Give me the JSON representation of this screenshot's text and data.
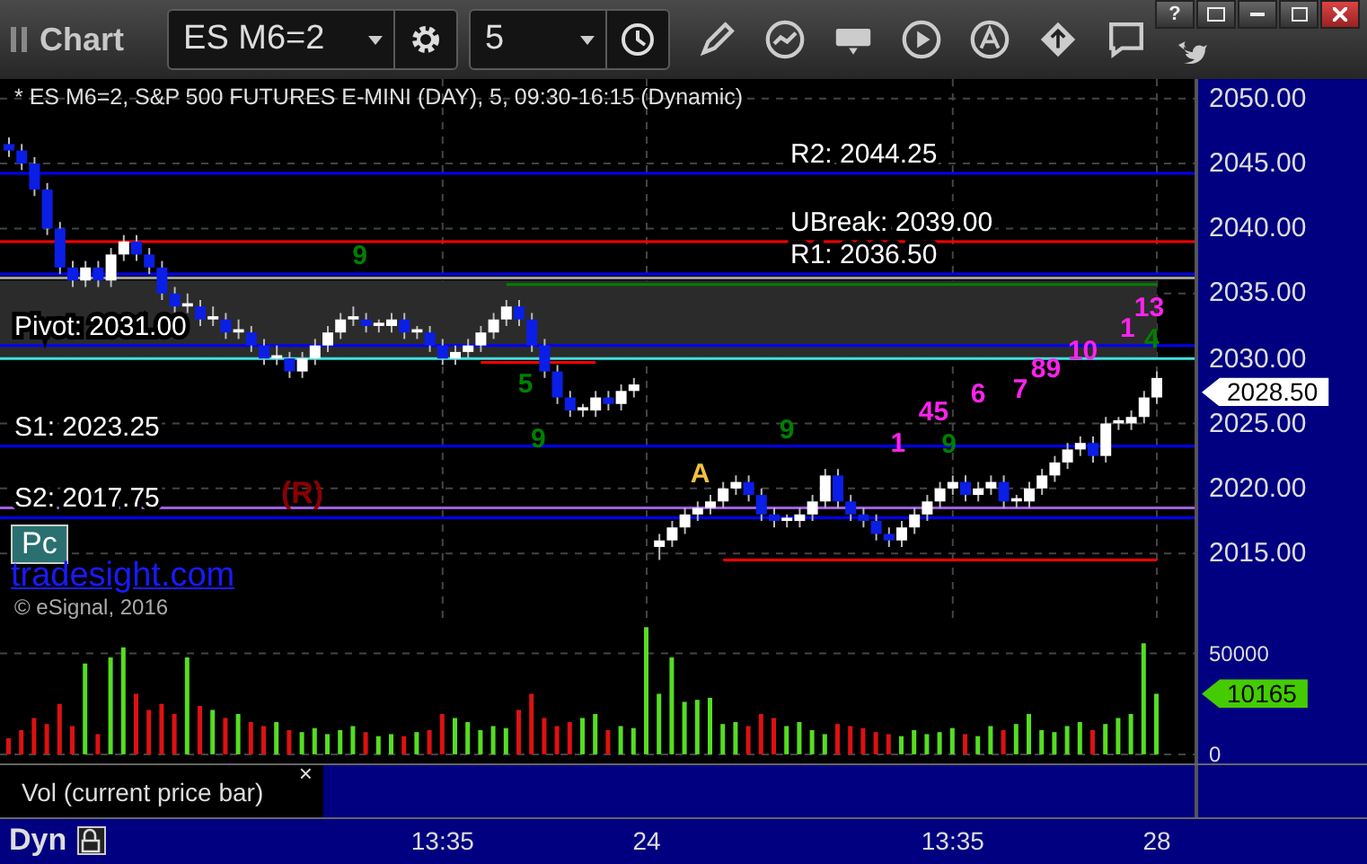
{
  "toolbar": {
    "title": "Chart",
    "symbol": "ES M6=2",
    "interval": "5",
    "help": "?"
  },
  "price_chart": {
    "title": "* ES M6=2, S&P 500 FUTURES E-MINI (DAY), 5, 09:30-16:15 (Dynamic)",
    "last_price": "2028.50",
    "badge": "Pc",
    "link": "tradesight.com",
    "copyright": "© eSignal, 2016",
    "markers": [
      {
        "text": "(R)",
        "color": "#8b0000"
      },
      {
        "text": "9",
        "color": "#008000"
      },
      {
        "text": "5",
        "color": "#008000"
      },
      {
        "text": "9",
        "color": "#008000"
      },
      {
        "text": "A",
        "color": "#f0c040"
      },
      {
        "text": "9",
        "color": "#008000"
      },
      {
        "text": "1",
        "color": "#ff22ee"
      },
      {
        "text": "45",
        "color": "#ff22ee"
      },
      {
        "text": "9",
        "color": "#008000"
      },
      {
        "text": "6",
        "color": "#ff22ee"
      },
      {
        "text": "7",
        "color": "#ff22ee"
      },
      {
        "text": "89",
        "color": "#ff22ee"
      },
      {
        "text": "10",
        "color": "#ff22ee"
      },
      {
        "text": "1",
        "color": "#ff22ee"
      },
      {
        "text": "13",
        "color": "#ff22ee"
      },
      {
        "text": "4",
        "color": "#008000"
      }
    ],
    "chart_data": {
      "type": "candlestick",
      "ohlc": [
        [
          2046.5,
          2047,
          2045.5,
          2046
        ],
        [
          2046,
          2046.5,
          2044.5,
          2045
        ],
        [
          2045,
          2045.5,
          2042.5,
          2043
        ],
        [
          2043,
          2043.5,
          2039.5,
          2040
        ],
        [
          2040,
          2040.5,
          2036.5,
          2037
        ],
        [
          2037,
          2037.5,
          2035.5,
          2036
        ],
        [
          2036,
          2037.5,
          2035.5,
          2037
        ],
        [
          2037,
          2037.5,
          2035.5,
          2036
        ],
        [
          2036,
          2038.5,
          2035.5,
          2038
        ],
        [
          2038,
          2039.5,
          2037.5,
          2039
        ],
        [
          2039,
          2039.5,
          2037.5,
          2038
        ],
        [
          2038,
          2038.5,
          2036.5,
          2037
        ],
        [
          2037,
          2037.5,
          2034.5,
          2035
        ],
        [
          2035,
          2035.5,
          2033.5,
          2034
        ],
        [
          2034,
          2035,
          2033.5,
          2034.25
        ],
        [
          2034,
          2034.5,
          2032.5,
          2033
        ],
        [
          2033,
          2034,
          2032.5,
          2033.25
        ],
        [
          2033,
          2033.5,
          2031.5,
          2032
        ],
        [
          2032,
          2033,
          2031.5,
          2032.25
        ],
        [
          2032,
          2032.5,
          2030.5,
          2031
        ],
        [
          2031,
          2031.5,
          2029.5,
          2030
        ],
        [
          2030,
          2031,
          2029.5,
          2030.25
        ],
        [
          2030,
          2030.5,
          2028.5,
          2029
        ],
        [
          2029,
          2030.5,
          2028.5,
          2030
        ],
        [
          2030,
          2031.5,
          2029.5,
          2031
        ],
        [
          2031,
          2032.5,
          2030.5,
          2032
        ],
        [
          2032,
          2033.5,
          2031.5,
          2033
        ],
        [
          2033,
          2034,
          2032.5,
          2033.25
        ],
        [
          2033,
          2033.5,
          2032,
          2032.5
        ],
        [
          2032.5,
          2033,
          2032,
          2032.75
        ],
        [
          2032.5,
          2033.5,
          2032,
          2033
        ],
        [
          2033,
          2033.5,
          2031.5,
          2032
        ],
        [
          2032,
          2032.5,
          2031.5,
          2032.25
        ],
        [
          2032,
          2032.5,
          2030.5,
          2031
        ],
        [
          2031,
          2031.5,
          2029.5,
          2030
        ],
        [
          2030,
          2031,
          2029.5,
          2030.5
        ],
        [
          2030.5,
          2031.5,
          2030,
          2031
        ],
        [
          2031,
          2032.5,
          2030.5,
          2032
        ],
        [
          2032,
          2033.5,
          2031.5,
          2033
        ],
        [
          2033,
          2034.5,
          2032.5,
          2034
        ],
        [
          2034,
          2034.5,
          2032.5,
          2033
        ],
        [
          2033,
          2033.5,
          2030.5,
          2031
        ],
        [
          2031,
          2031.5,
          2028.5,
          2029
        ],
        [
          2029,
          2029.5,
          2026.5,
          2027
        ],
        [
          2027,
          2027.5,
          2025.5,
          2026
        ],
        [
          2026,
          2026.5,
          2025.5,
          2026.25
        ],
        [
          2026,
          2027.5,
          2025.5,
          2027
        ],
        [
          2027,
          2027.5,
          2026,
          2026.5
        ],
        [
          2026.5,
          2028,
          2026,
          2027.5
        ],
        [
          2027.5,
          2028.5,
          2027,
          2028
        ],
        null,
        [
          2015.5,
          2016.5,
          2014.5,
          2016
        ],
        [
          2016,
          2017.5,
          2015.5,
          2017
        ],
        [
          2017,
          2018.5,
          2016.5,
          2018
        ],
        [
          2018,
          2019,
          2017.5,
          2018.5
        ],
        [
          2018.5,
          2019.5,
          2018,
          2019
        ],
        [
          2019,
          2020.5,
          2018.5,
          2020
        ],
        [
          2020,
          2021,
          2019.5,
          2020.5
        ],
        [
          2020.5,
          2021,
          2019,
          2019.5
        ],
        [
          2019.5,
          2020,
          2017.5,
          2018
        ],
        [
          2018,
          2018.5,
          2017,
          2017.5
        ],
        [
          2017.5,
          2018,
          2017,
          2017.75
        ],
        [
          2017.5,
          2018.5,
          2017,
          2018
        ],
        [
          2018,
          2019.5,
          2017.5,
          2019
        ],
        [
          2019,
          2021.5,
          2018.5,
          2021
        ],
        [
          2021,
          2021.5,
          2018.5,
          2019
        ],
        [
          2019,
          2019.5,
          2017.5,
          2018
        ],
        [
          2018,
          2018.5,
          2017,
          2017.5
        ],
        [
          2017.5,
          2018,
          2016,
          2016.5
        ],
        [
          2016.5,
          2017,
          2015.5,
          2016
        ],
        [
          2016,
          2017.5,
          2015.5,
          2017
        ],
        [
          2017,
          2018.5,
          2016.5,
          2018
        ],
        [
          2018,
          2019.5,
          2017.5,
          2019
        ],
        [
          2019,
          2020.5,
          2018.5,
          2020
        ],
        [
          2020,
          2021,
          2019.5,
          2020.5
        ],
        [
          2020.5,
          2021,
          2019,
          2019.5
        ],
        [
          2019.5,
          2020.5,
          2019,
          2020
        ],
        [
          2020,
          2021,
          2019.5,
          2020.5
        ],
        [
          2020.5,
          2021,
          2018.5,
          2019
        ],
        [
          2019,
          2019.5,
          2018.5,
          2019.25
        ],
        [
          2019,
          2020.5,
          2018.5,
          2020
        ],
        [
          2020,
          2021.5,
          2019.5,
          2021
        ],
        [
          2021,
          2022.5,
          2020.5,
          2022
        ],
        [
          2022,
          2023.5,
          2021.5,
          2023
        ],
        [
          2023,
          2024,
          2022.5,
          2023.5
        ],
        [
          2023.5,
          2024,
          2022,
          2022.5
        ],
        [
          2022.5,
          2025.5,
          2022,
          2025
        ],
        [
          2025,
          2025.5,
          2024.5,
          2025.25
        ],
        [
          2025,
          2026,
          2024.5,
          2025.5
        ],
        [
          2025.5,
          2027.5,
          2025,
          2027
        ],
        [
          2027,
          2029,
          2026.5,
          2028.5
        ]
      ],
      "ylim": [
        2009.9,
        2051.5
      ],
      "yticks": [
        {
          "value": 2015,
          "label": "2015.00"
        },
        {
          "value": 2020,
          "label": "2020.00"
        },
        {
          "value": 2025,
          "label": "2025.00"
        },
        {
          "value": 2030,
          "label": "2030.00"
        },
        {
          "value": 2035,
          "label": "2035.00"
        },
        {
          "value": 2040,
          "label": "2040.00"
        },
        {
          "value": 2045,
          "label": "2045.00"
        },
        {
          "value": 2050,
          "label": "2050.00"
        }
      ],
      "grid": true,
      "bands": [
        {
          "axis": "y",
          "from": 2030,
          "to": 2036,
          "color": "#2b2b2b"
        }
      ],
      "ref_lines": [
        {
          "axis": "y",
          "value": 2044.25,
          "color": "#0000ff",
          "label": "R2: 2044.25"
        },
        {
          "axis": "y",
          "value": 2039,
          "color": "#ff0000",
          "label": "UBreak: 2039.00"
        },
        {
          "axis": "y",
          "value": 2036.5,
          "color": "#0000ff",
          "label": "R1: 2036.50"
        },
        {
          "axis": "y",
          "value": 2036.2,
          "color": "#a0a0a0"
        },
        {
          "axis": "y",
          "value": 2035.7,
          "color": "#008000"
        },
        {
          "axis": "y",
          "value": 2031,
          "color": "#0000ff",
          "label": "Pivot: 2031.00"
        },
        {
          "axis": "y",
          "value": 2030,
          "color": "#40e0e0"
        },
        {
          "axis": "y",
          "value": 2029.7,
          "color": "#ff0000"
        },
        {
          "axis": "y",
          "value": 2023.25,
          "color": "#0000ff",
          "label": "S1: 2023.25"
        },
        {
          "axis": "y",
          "value": 2018.5,
          "color": "#a060e0"
        },
        {
          "axis": "y",
          "value": 2017.75,
          "color": "#0000ff",
          "label": "S2: 2017.75"
        },
        {
          "axis": "y",
          "value": 2014.5,
          "color": "#ff0000"
        }
      ]
    }
  },
  "volume_chart": {
    "label": "Vol (current price bar)",
    "close": "×",
    "last_volume": "10165",
    "chart_data": {
      "type": "bar",
      "values": [
        8000,
        12000,
        18000,
        15000,
        25000,
        14000,
        45000,
        10000,
        48000,
        53000,
        30000,
        22000,
        25000,
        20000,
        48000,
        24000,
        22000,
        18000,
        20000,
        16000,
        14000,
        16000,
        12000,
        11000,
        13000,
        10000,
        12000,
        14000,
        11000,
        9000,
        10000,
        9000,
        11000,
        12000,
        20000,
        18000,
        16000,
        12000,
        14000,
        13000,
        22000,
        30000,
        18000,
        14000,
        16000,
        18000,
        20000,
        12000,
        14000,
        13000,
        63000,
        30000,
        48000,
        26000,
        27000,
        28000,
        15000,
        16000,
        14000,
        20000,
        18000,
        14000,
        16000,
        12000,
        10000,
        15000,
        14000,
        13000,
        11000,
        10000,
        9000,
        12000,
        10000,
        11000,
        13000,
        10000,
        9000,
        14000,
        12000,
        15000,
        20000,
        12000,
        11000,
        14000,
        16000,
        12000,
        15000,
        18000,
        20000,
        55000,
        30000
      ],
      "ylim": [
        -4500,
        66700
      ],
      "grid": true,
      "yticks": [
        {
          "value": 0,
          "label": "0"
        },
        {
          "value": 50000,
          "label": "50000"
        }
      ]
    }
  },
  "time_axis": {
    "mode": "Dyn",
    "labels": [
      "13:35",
      "24",
      "13:35",
      "28"
    ]
  }
}
